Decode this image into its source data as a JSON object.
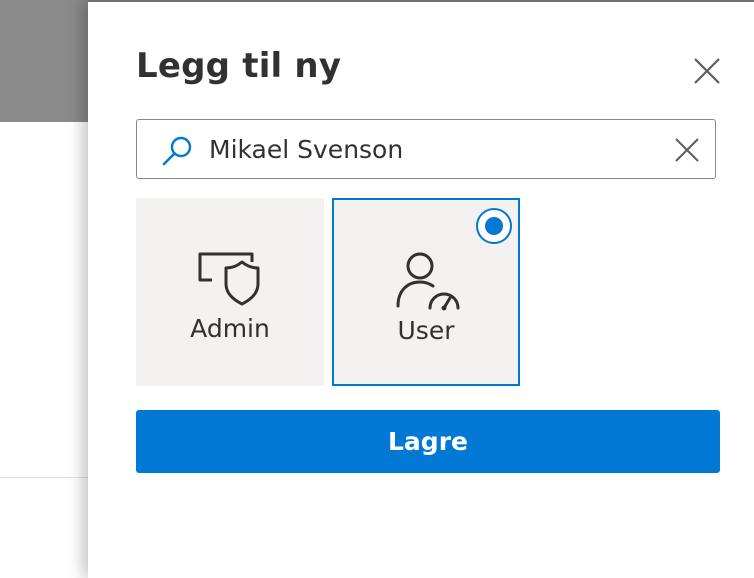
{
  "panel": {
    "title": "Legg til ny",
    "close_icon": "close-icon"
  },
  "search": {
    "value": "Mikael Svenson",
    "icon": "search-icon",
    "clear_icon": "clear-icon"
  },
  "roles": [
    {
      "label": "Admin",
      "icon": "admin-shield-icon",
      "selected": false
    },
    {
      "label": "User",
      "icon": "user-icon",
      "selected": true
    }
  ],
  "actions": {
    "save_label": "Lagre"
  },
  "colors": {
    "accent": "#0078d4",
    "tile_bg": "#f3f2f1",
    "text": "#323130",
    "overlay_header": "#8a8a8a"
  }
}
